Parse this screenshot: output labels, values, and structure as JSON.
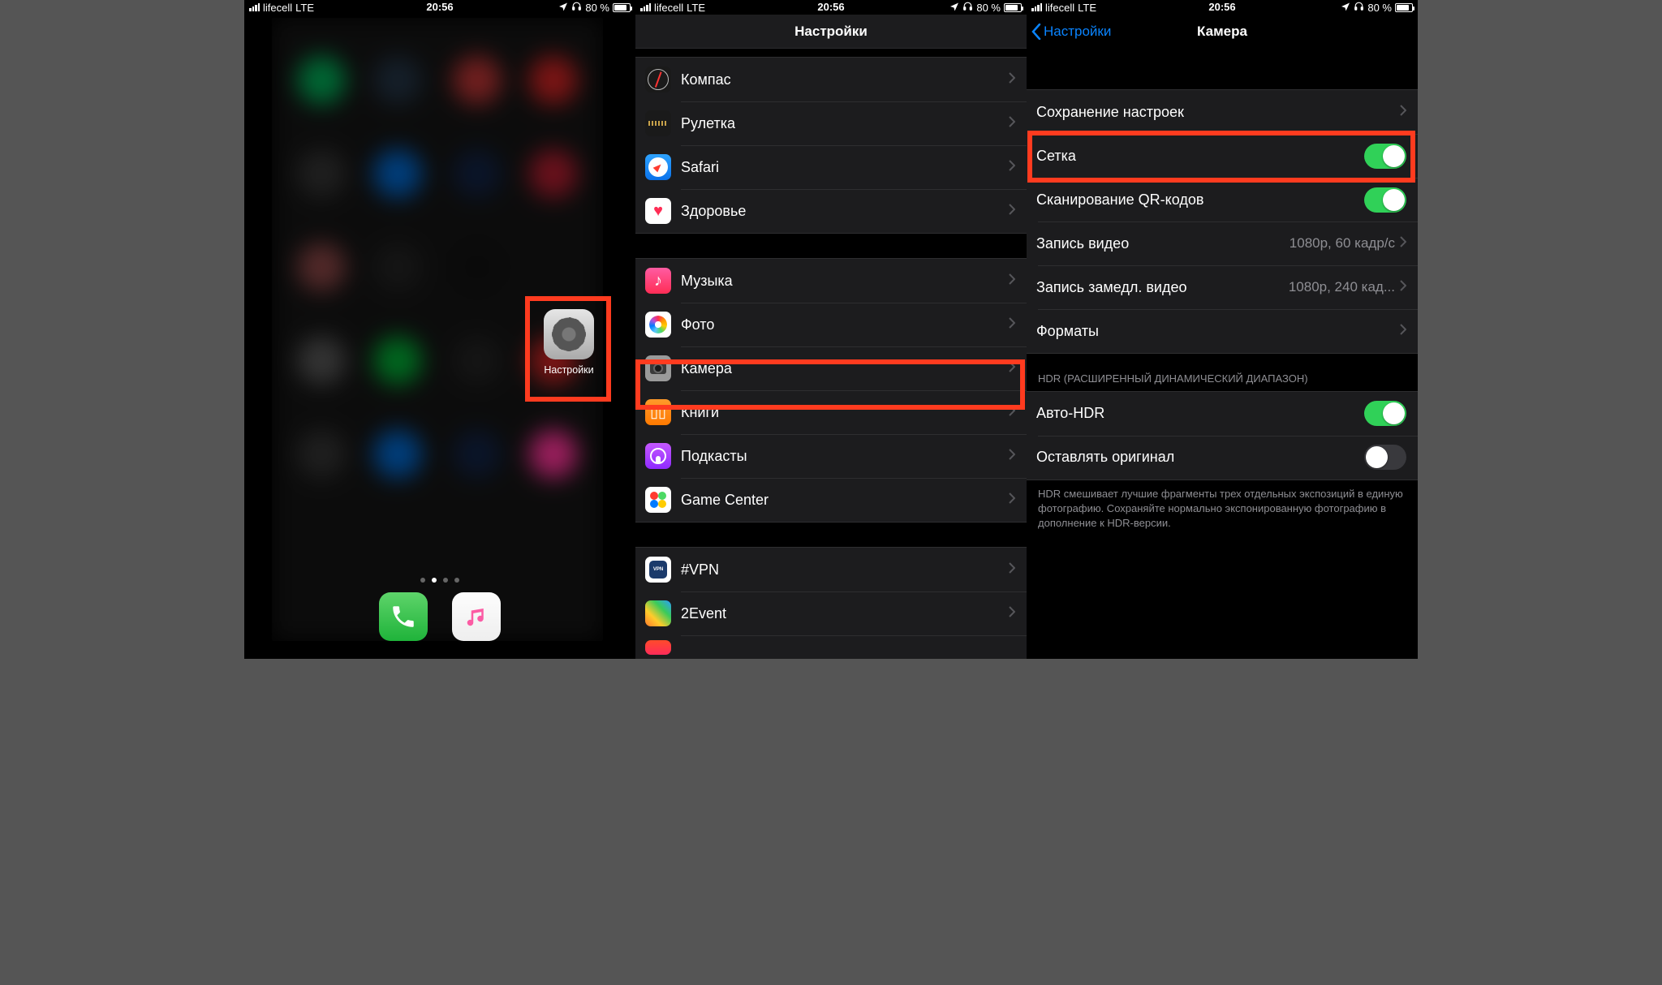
{
  "status": {
    "carrier": "lifecell",
    "network": "LTE",
    "time": "20:56",
    "battery_pct": "80 %"
  },
  "highlight_color": "#ff3b1f",
  "screen1": {
    "settings_label": "Настройки"
  },
  "screen2": {
    "title": "Настройки",
    "groups": [
      [
        {
          "icon": "compass",
          "label": "Компас"
        },
        {
          "icon": "measure",
          "label": "Рулетка"
        },
        {
          "icon": "safari",
          "label": "Safari"
        },
        {
          "icon": "health",
          "label": "Здоровье"
        }
      ],
      [
        {
          "icon": "music",
          "label": "Музыка"
        },
        {
          "icon": "photos",
          "label": "Фото"
        },
        {
          "icon": "camera",
          "label": "Камера",
          "highlighted": true
        },
        {
          "icon": "books",
          "label": "Книги"
        },
        {
          "icon": "podcasts",
          "label": "Подкасты"
        },
        {
          "icon": "gamecenter",
          "label": "Game Center"
        }
      ],
      [
        {
          "icon": "vpn",
          "label": "#VPN"
        },
        {
          "icon": "2event",
          "label": "2Event"
        },
        {
          "icon": "unknown",
          "label": ""
        }
      ]
    ]
  },
  "screen3": {
    "back": "Настройки",
    "title": "Камера",
    "rows": [
      {
        "type": "link",
        "label": "Сохранение настроек"
      },
      {
        "type": "toggle",
        "label": "Сетка",
        "on": true,
        "highlighted": true
      },
      {
        "type": "toggle",
        "label": "Сканирование QR-кодов",
        "on": true
      },
      {
        "type": "link",
        "label": "Запись видео",
        "detail": "1080p, 60 кадр/с"
      },
      {
        "type": "link",
        "label": "Запись замедл. видео",
        "detail": "1080p, 240 кад..."
      },
      {
        "type": "link",
        "label": "Форматы"
      }
    ],
    "hdr_header": "HDR (РАСШИРЕННЫЙ ДИНАМИЧЕСКИЙ ДИАПАЗОН)",
    "hdr_rows": [
      {
        "type": "toggle",
        "label": "Авто-HDR",
        "on": true
      },
      {
        "type": "toggle",
        "label": "Оставлять оригинал",
        "on": false
      }
    ],
    "hdr_footer": "HDR смешивает лучшие фрагменты трех отдельных экспозиций в единую фотографию. Сохраняйте нормально экспонированную фотографию в дополнение к HDR-версии."
  }
}
